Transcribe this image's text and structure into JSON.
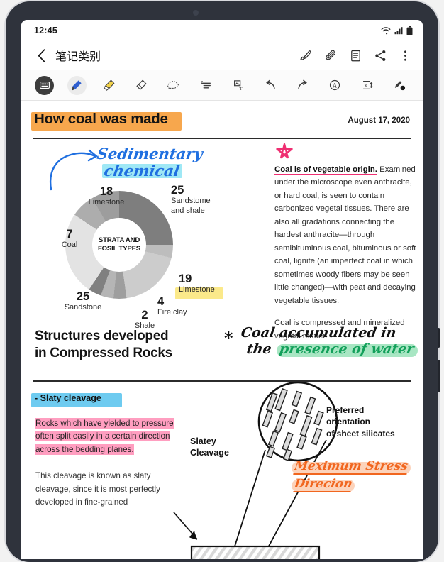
{
  "status_bar": {
    "clock": "12:45",
    "icons": [
      "wifi-icon",
      "signal-icon",
      "battery-icon"
    ]
  },
  "app_bar": {
    "back_icon": "chevron-left-icon",
    "title": "笔记类别",
    "actions": [
      {
        "name": "pen-mode-icon",
        "label": "Pen mode"
      },
      {
        "name": "attach-icon",
        "label": "Attach"
      },
      {
        "name": "page-view-icon",
        "label": "Page view"
      },
      {
        "name": "share-icon",
        "label": "Share"
      },
      {
        "name": "more-options-icon",
        "label": "More options"
      }
    ]
  },
  "toolbar": {
    "tools": [
      {
        "name": "keyboard-tool",
        "label": "Keyboard",
        "state": "selected-dark"
      },
      {
        "name": "pen-tool",
        "label": "Pen",
        "state": "selected-light"
      },
      {
        "name": "highlighter-tool",
        "label": "Highlighter",
        "state": "normal"
      },
      {
        "name": "eraser-tool",
        "label": "Eraser",
        "state": "normal"
      },
      {
        "name": "lasso-select-tool",
        "label": "Selection",
        "state": "normal"
      },
      {
        "name": "auto-format-tool",
        "label": "Auto format",
        "state": "normal"
      },
      {
        "name": "convert-to-text-tool",
        "label": "Convert to text",
        "state": "normal"
      },
      {
        "name": "undo-tool",
        "label": "Undo",
        "state": "normal"
      },
      {
        "name": "redo-tool",
        "label": "Redo",
        "state": "normal"
      },
      {
        "name": "text-recognition-tool",
        "label": "Text recognition",
        "state": "normal"
      },
      {
        "name": "text-settings-tool",
        "label": "Text settings",
        "state": "normal"
      },
      {
        "name": "pen-settings-tool",
        "label": "Pen settings",
        "state": "normal"
      }
    ]
  },
  "note": {
    "title": "How coal was made",
    "date": "August 17, 2020",
    "handwriting_sedimentary_line1": "Sedimentary",
    "handwriting_sedimentary_line2": "chemical",
    "chart_center_line1": "STRATA AND",
    "chart_center_line2": "FOSIL TYPES",
    "highlighted_limestone_num": "19",
    "highlighted_limestone_label": "Limestone",
    "body_bold": "Coal is of vegetable origin.",
    "body_p1": " Examined under the microscope even anthracite, or hard coal, is seen to contain carbonized vegetal tissues. There are also all gradations connecting the hardest anthracite—through semibituminous coal, bituminous or soft coal, lignite (an imperfect coal in which sometimes woody fibers may be seen little changed)—with peat and decaying vegetable tissues.",
    "body_p2": "Coal is compressed and mineralized vegetal matter.",
    "heading2_line1": "Structures developed",
    "heading2_line2": "in Compressed Rocks",
    "hand_coal_line1": "Coal accumulated in",
    "hand_coal_line2_plain": "the",
    "hand_coal_line2_green": "presence of water",
    "hand_star": "*",
    "slaty_cleavage_label": "- Slaty cleavage",
    "pink_para_line1": "Rocks which have yielded to pressure",
    "pink_para_line2": "often split easily in a certain direction",
    "pink_para_line3": "across the bedding planes.",
    "last_para": "This cleavage is known as slaty cleavage, since it is most perfectly developed in fine-grained",
    "diagram_slatey_line1": "Slatey",
    "diagram_slatey_line2": "Cleavage",
    "diagram_pref_line1": "Preferred",
    "diagram_pref_line2": "orientation",
    "diagram_pref_line3": "of sheet silicates",
    "max_stress_line1": "Meximum Stress",
    "max_stress_line2": "Direcion"
  },
  "colors": {
    "title_highlight": "#f7a74d",
    "cyan_highlight": "#9fe8f5",
    "yellow_highlight": "#fbe98a",
    "green_highlight": "#a8e6c3",
    "pink_highlight": "#ff9ec0",
    "blue_highlight": "#6ecbf0",
    "orange_highlight": "#fcd3bb",
    "handwriting_blue": "#1f6fe0",
    "handwriting_green": "#12a05a",
    "handwriting_orange": "#f1661f",
    "star_pink": "#ef2f72",
    "bezel": "#2f333c"
  },
  "chart_data": {
    "type": "pie",
    "title": "STRATA AND FOSIL TYPES",
    "legend_position": "around",
    "labels": [
      "Sandstome and shale",
      "Limestone",
      "Fire clay",
      "Shale",
      "Sandstone",
      "Coal",
      "Limestone"
    ],
    "values": [
      25,
      19,
      4,
      2,
      25,
      7,
      18
    ],
    "colors": [
      "#7e7e7e",
      "#cccccc",
      "#bdbdbd",
      "#8e8e8e",
      "#e0e0e0",
      "#adadad",
      "#9d9d9d"
    ],
    "annotations": [
      {
        "num": "18",
        "name": "Limestone"
      },
      {
        "num": "25",
        "name": "Sandstome and shale"
      },
      {
        "num": "7",
        "name": "Coal"
      },
      {
        "num": "19",
        "name": "Limestone",
        "highlight": "yellow"
      },
      {
        "num": "25",
        "name": "Sandstone"
      },
      {
        "num": "2",
        "name": "Shale"
      },
      {
        "num": "4",
        "name": "Fire clay"
      }
    ]
  }
}
